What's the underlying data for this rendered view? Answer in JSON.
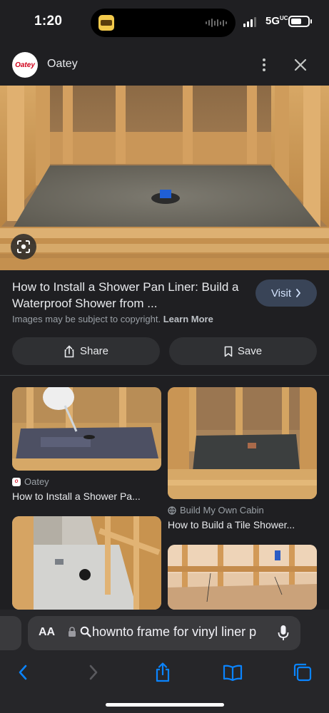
{
  "status_bar": {
    "time": "1:20",
    "network": "5G",
    "network_sup": "UC"
  },
  "header": {
    "source_name": "Oatey",
    "logo_text": "Oatey",
    "more_icon": "vertical-ellipsis-icon",
    "close_icon": "close-icon"
  },
  "hero": {
    "lens_icon": "google-lens-icon"
  },
  "result": {
    "title": "How to Install a Shower Pan Liner: Build a Waterproof Shower from ...",
    "visit_label": "Visit",
    "copyright_text": "Images may be subject to copyright.",
    "learn_more": "Learn More",
    "share_label": "Share",
    "save_label": "Save"
  },
  "related": [
    {
      "source": "Oatey",
      "title": "How to Install a Shower Pa..."
    },
    {
      "source": "Build My Own Cabin",
      "title": "How to Build a Tile Shower..."
    }
  ],
  "safari": {
    "aa_label": "AA",
    "url_text": "hownto frame for vinyl liner p",
    "buttons": [
      "back-icon",
      "forward-icon",
      "share-icon",
      "bookmarks-icon",
      "tabs-icon"
    ]
  },
  "colors": {
    "accent": "#0a84ff",
    "visit_bg": "#394457",
    "pill_bg": "#2f3033"
  }
}
